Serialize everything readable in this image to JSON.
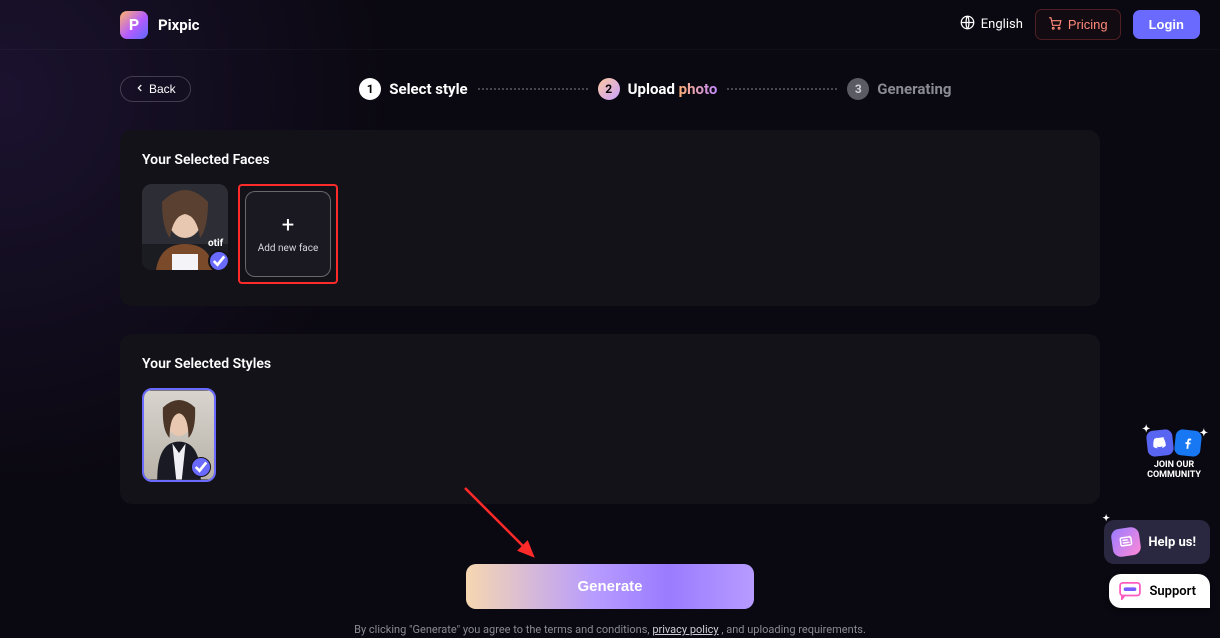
{
  "header": {
    "brand_letter": "P",
    "brand_name": "Pixpic",
    "language_label": "English",
    "pricing_label": "Pricing",
    "login_label": "Login"
  },
  "back_label": "Back",
  "steps": {
    "s1": {
      "num": "1",
      "label": "Select style"
    },
    "s2": {
      "num": "2",
      "label_prefix": "Upload ",
      "label_accent": "photo"
    },
    "s3": {
      "num": "3",
      "label": "Generating"
    }
  },
  "faces": {
    "heading": "Your Selected Faces",
    "add_label": "Add new face"
  },
  "styles": {
    "heading": "Your Selected Styles"
  },
  "generate": {
    "button_label": "Generate",
    "terms_prefix": "By clicking \"Generate\" you agree to the terms and conditions, ",
    "terms_link": "privacy policy",
    "terms_suffix": " , and uploading requirements."
  },
  "community": {
    "line1": "JOIN OUR",
    "line2": "COMMUNITY"
  },
  "helpus_label": "Help us!",
  "support_label": "Support"
}
